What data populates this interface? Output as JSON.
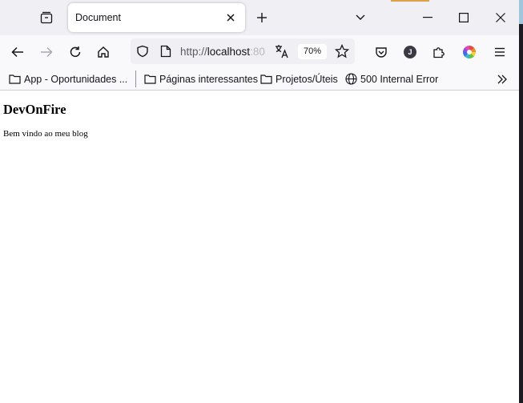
{
  "window": {
    "tab": {
      "title": "Document"
    }
  },
  "nav": {
    "url_scheme": "http://",
    "url_host": "localhost",
    "url_port": ":80",
    "zoom": "70%"
  },
  "bookmarks": [
    {
      "label": "App - Oportunidades ...",
      "icon": "folder-icon"
    },
    {
      "label": "Páginas interessantes",
      "icon": "folder-icon"
    },
    {
      "label": "Projetos/Úteis",
      "icon": "folder-icon"
    },
    {
      "label": "500 Internal Error",
      "icon": "globe-icon"
    }
  ],
  "profile": {
    "initial": "J"
  },
  "page": {
    "heading": "DevOnFire",
    "paragraph": "Bem vindo ao meu blog"
  }
}
